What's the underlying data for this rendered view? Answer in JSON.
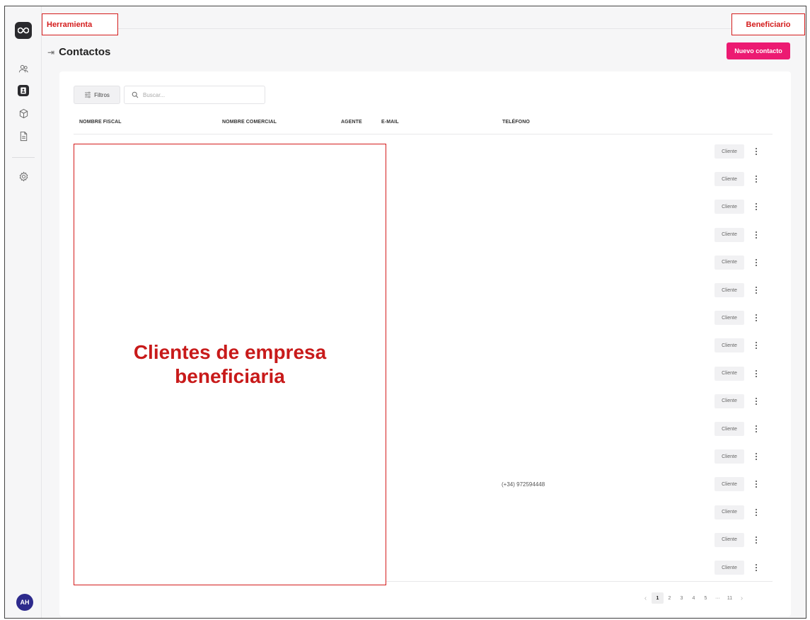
{
  "annotations": {
    "tool_label": "Herramienta",
    "beneficiary_label": "Beneficiario",
    "region_label": "Clientes de empresa beneficiaria"
  },
  "sidebar": {
    "avatar_initials": "AH",
    "items": [
      {
        "icon": "contacts-group-icon"
      },
      {
        "icon": "address-book-icon",
        "active": true
      },
      {
        "icon": "cube-icon"
      },
      {
        "icon": "document-icon"
      },
      {
        "icon": "settings-gear-icon"
      }
    ]
  },
  "header": {
    "title": "Contactos",
    "new_contact_label": "Nuevo contacto"
  },
  "toolbar": {
    "filters_label": "Filtros",
    "search_placeholder": "Buscar..."
  },
  "table": {
    "columns": [
      "NOMBRE FISCAL",
      "NOMBRE COMERCIAL",
      "AGENTE",
      "E-MAIL",
      "TELÉFONO"
    ],
    "rows": [
      {
        "phone": "",
        "type": "Cliente"
      },
      {
        "phone": "",
        "type": "Cliente"
      },
      {
        "phone": "",
        "type": "Cliente"
      },
      {
        "phone": "",
        "type": "Cliente"
      },
      {
        "phone": "",
        "type": "Cliente"
      },
      {
        "phone": "",
        "type": "Cliente"
      },
      {
        "phone": "",
        "type": "Cliente"
      },
      {
        "phone": "",
        "type": "Cliente"
      },
      {
        "phone": "",
        "type": "Cliente"
      },
      {
        "phone": "",
        "type": "Cliente"
      },
      {
        "phone": "",
        "type": "Cliente"
      },
      {
        "phone": "",
        "type": "Cliente"
      },
      {
        "phone": "(+34) 972594448",
        "type": "Cliente"
      },
      {
        "phone": "",
        "type": "Cliente"
      },
      {
        "phone": "",
        "type": "Cliente"
      },
      {
        "phone": "",
        "type": "Cliente"
      }
    ]
  },
  "pagination": {
    "prev": "‹",
    "pages": [
      "1",
      "2",
      "3",
      "4",
      "5",
      "···",
      "11"
    ],
    "current": "1",
    "next": "›"
  },
  "colors": {
    "accent": "#ec1a72",
    "annotation": "#d41c1c",
    "avatar": "#2d2a8c"
  }
}
